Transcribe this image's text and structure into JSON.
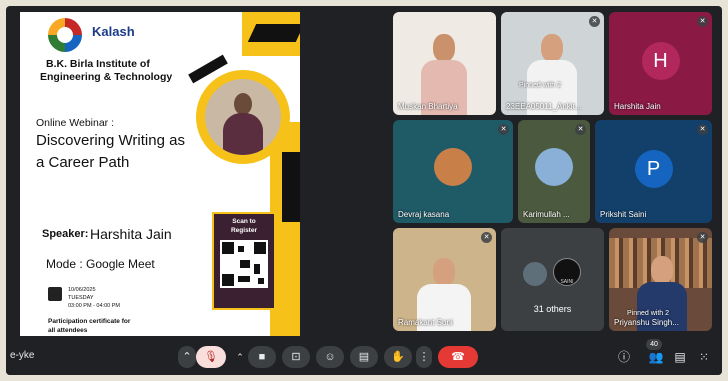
{
  "meeting": {
    "code": "e-yke"
  },
  "slide": {
    "brand": "Kalash",
    "institute_line1": "B.K. Birla Institute of",
    "institute_line2": "Engineering & Technology",
    "webinar_label": "Online Webinar :",
    "title_line1": "Discovering Writing as",
    "title_line2": "a Career Path",
    "speaker_label": "Speaker:",
    "speaker_name": "Harshita Jain",
    "mode_line": "Mode : Google Meet",
    "date": "10/06/2025",
    "day": "TUESDAY",
    "time": "03:00 PM - 04:00 PM",
    "certificate_line1": "Participation certificate for",
    "certificate_line2": "all attendees",
    "scan_line1": "Scan to",
    "scan_line2": "Register"
  },
  "participants": [
    {
      "name": "Muskan Bhartiya",
      "muted": false
    },
    {
      "name": "23EEA05011_Ankit...",
      "muted": true,
      "overlay": "Pinned with 2"
    },
    {
      "name": "Harshita Jain",
      "initial": "H",
      "avatar_color": "#a3204f",
      "muted": true
    },
    {
      "name": "Devraj kasana",
      "muted": true
    },
    {
      "name": "Karimullah ...",
      "muted": true
    },
    {
      "name": "Prikshit Saini",
      "initial": "P",
      "avatar_color": "#1565c0",
      "muted": true
    },
    {
      "name": "Ramakant Soni",
      "muted": true
    },
    {
      "name": "31 others",
      "others_badge": "SAINI"
    },
    {
      "name": "Priyanshu Singh...",
      "muted": true,
      "overlay": "Pinned with 2"
    }
  ],
  "controls": {
    "people_count": "40",
    "icons": [
      "chevron-up",
      "mic-off",
      "chevron-up",
      "camera",
      "present",
      "emoji",
      "captions",
      "raise-hand",
      "more",
      "end-call",
      "info",
      "people",
      "chat",
      "activities"
    ]
  }
}
